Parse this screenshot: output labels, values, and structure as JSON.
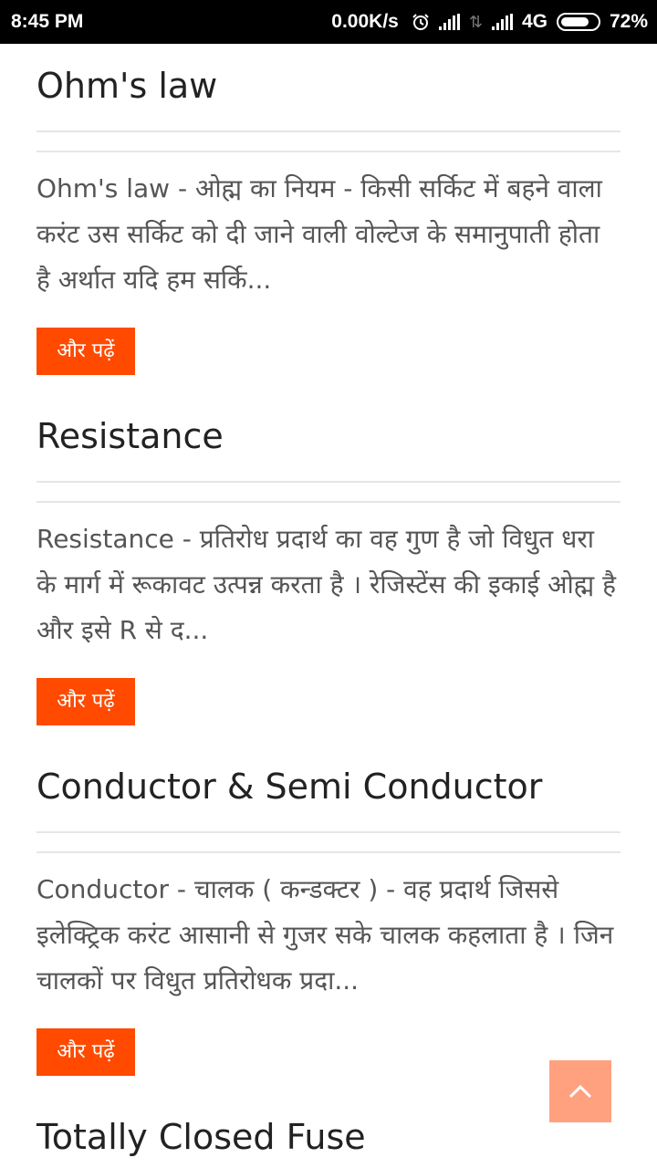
{
  "status_bar": {
    "time": "8:45 PM",
    "net_speed": "0.00K/s",
    "network_type": "4G",
    "battery": "72%",
    "battery_level": 0.72,
    "icons": [
      "alarm-icon",
      "signal-icon",
      "data-arrows-icon",
      "signal-icon",
      "battery-icon"
    ]
  },
  "read_more_label": "और पढ़ें",
  "articles": [
    {
      "title": "Ohm's law",
      "excerpt": "Ohm's law  -  ओह्म का नियम - किसी सर्किट में बहने वाला करंट उस सर्किट को दी जाने वाली वोल्टेज के समानुपाती होता है अर्थात यदि हम सर्कि..."
    },
    {
      "title": "Resistance",
      "excerpt": "Resistance  -  प्रतिरोध प्रदार्थ का वह गुण है जो विधुत धरा के मार्ग में रूकावट उत्पन्न करता है । रेजिस्टेंस की इकाई ओह्म है और इसे R से द..."
    },
    {
      "title": "Conductor & Semi Conductor",
      "excerpt": "Conductor   -  चालक ( कन्डक्टर ) - वह प्रदार्थ जिससे इलेक्ट्रिक करंट आसानी से गुजर सके चालक कहलाता है । जिन चालकों पर विधुत प्रतिरोधक प्रदा..."
    },
    {
      "title": "Totally Closed Fuse"
    }
  ],
  "scroll_top_icon": "chevron-up-icon",
  "colors": {
    "accent": "#ff4a00",
    "scroll_top": "#ffa07f",
    "status_bar": "#000000"
  }
}
